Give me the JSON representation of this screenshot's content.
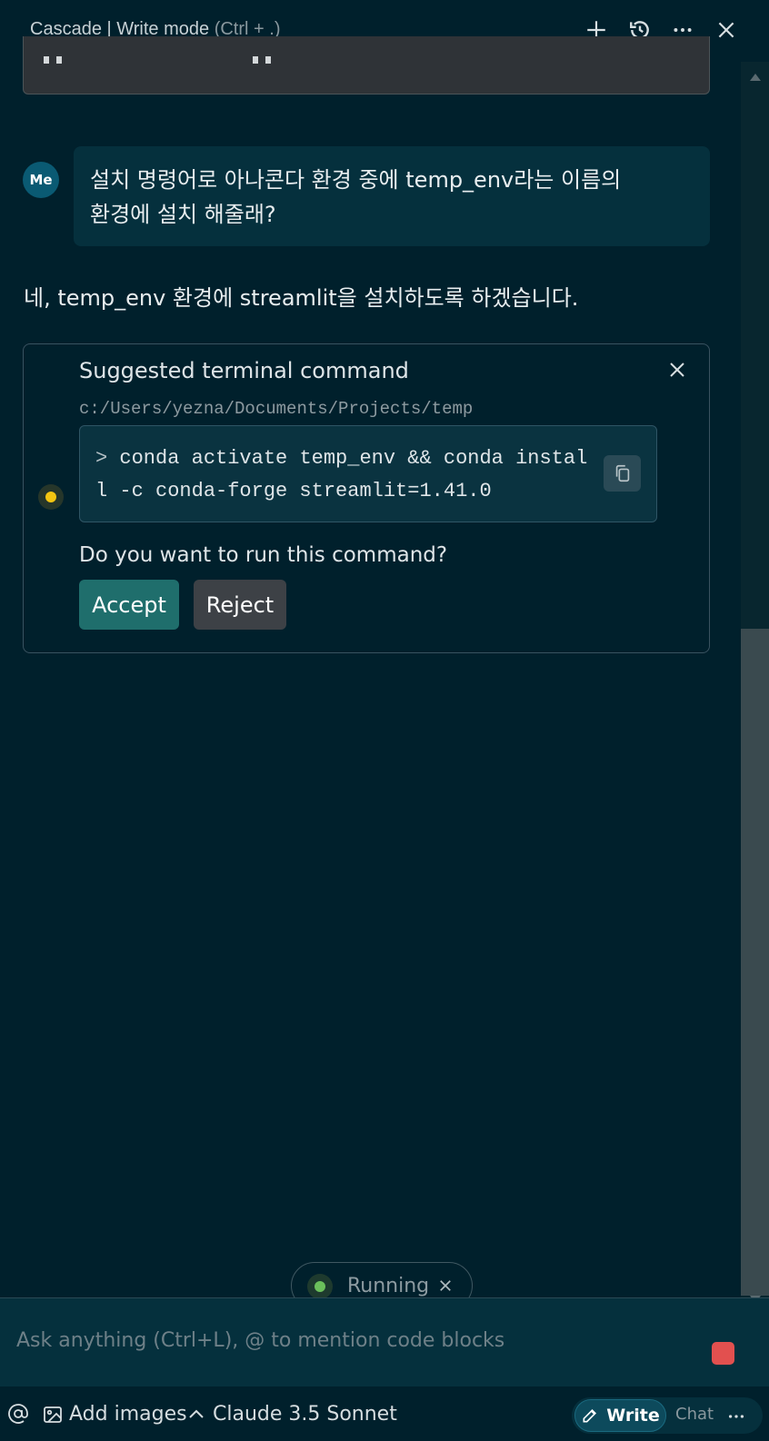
{
  "header": {
    "title": "Cascade | Write mode",
    "shortcut_hint": "(Ctrl + .)",
    "actions": [
      "plus-icon",
      "history-icon",
      "more-icon",
      "close-icon"
    ]
  },
  "conversation": {
    "user": {
      "avatar": "Me",
      "message_line1": "설치 명령어로 아나콘다 환경 중에 temp_env라는 이름의",
      "message_line2": "환경에 설치 해줄래?"
    },
    "assistant": {
      "message": "네, temp_env 환경에 streamlit을 설치하도록 하겠습니다."
    }
  },
  "command_card": {
    "title": "Suggested terminal command",
    "cwd": "c:/Users/yezna/Documents/Projects/temp",
    "prompt": ">",
    "command": "conda activate temp_env && conda install -c conda-forge streamlit=1.41.0",
    "question": "Do you want to run this command?",
    "accept_label": "Accept",
    "reject_label": "Reject",
    "status_color": "#f3c512"
  },
  "status": {
    "label": "Running",
    "color": "#6bbf5b"
  },
  "input": {
    "placeholder": "Ask anything (Ctrl+L), @ to mention code blocks",
    "value": ""
  },
  "footer": {
    "add_images_label": "Add images",
    "model_label": "Claude 3.5 Sonnet",
    "write_label": "Write",
    "chat_label": "Chat"
  },
  "colors": {
    "background": "#00202c",
    "accent": "#1f6e6c",
    "stop": "#e2504f"
  }
}
